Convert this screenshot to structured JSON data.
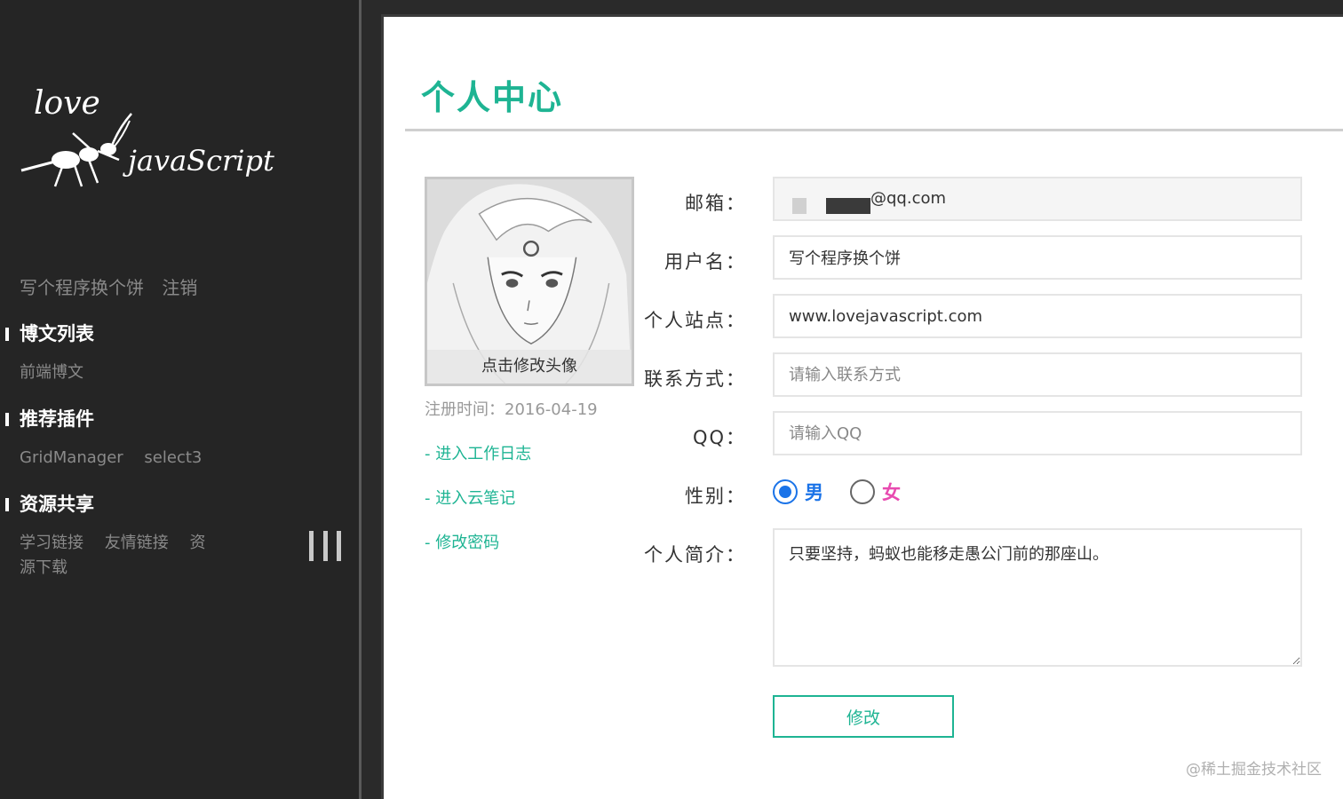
{
  "sidebar": {
    "user_links": [
      "写个程序换个饼",
      "注销"
    ],
    "sections": [
      {
        "title": "博文列表",
        "links": [
          "前端博文"
        ]
      },
      {
        "title": "推荐插件",
        "links": [
          "GridManager",
          "select3"
        ]
      },
      {
        "title": "资源共享",
        "links": [
          "学习链接",
          "友情链接",
          "资源下载"
        ]
      }
    ]
  },
  "main": {
    "title": "个人中心",
    "avatar_caption": "点击修改头像",
    "register_time": "注册时间：2016-04-19",
    "side_links": [
      "- 进入工作日志",
      "- 进入云笔记",
      "- 修改密码"
    ],
    "form": {
      "email_label": "邮箱：",
      "email_value": "@qq.com",
      "username_label": "用户名：",
      "username_value": "写个程序换个饼",
      "site_label": "个人站点：",
      "site_value": "www.lovejavascript.com",
      "contact_label": "联系方式：",
      "contact_placeholder": "请输入联系方式",
      "qq_label": "QQ：",
      "qq_placeholder": "请输入QQ",
      "gender_label": "性别：",
      "gender_male": "男",
      "gender_female": "女",
      "bio_label": "个人简介：",
      "bio_value": "只要坚持，蚂蚁也能移走愚公门前的那座山。",
      "submit_label": "修改"
    }
  },
  "watermark": "@稀土掘金技术社区",
  "colors": {
    "accent": "#1eb493",
    "male": "#1a73e8",
    "female": "#e84bb0"
  }
}
